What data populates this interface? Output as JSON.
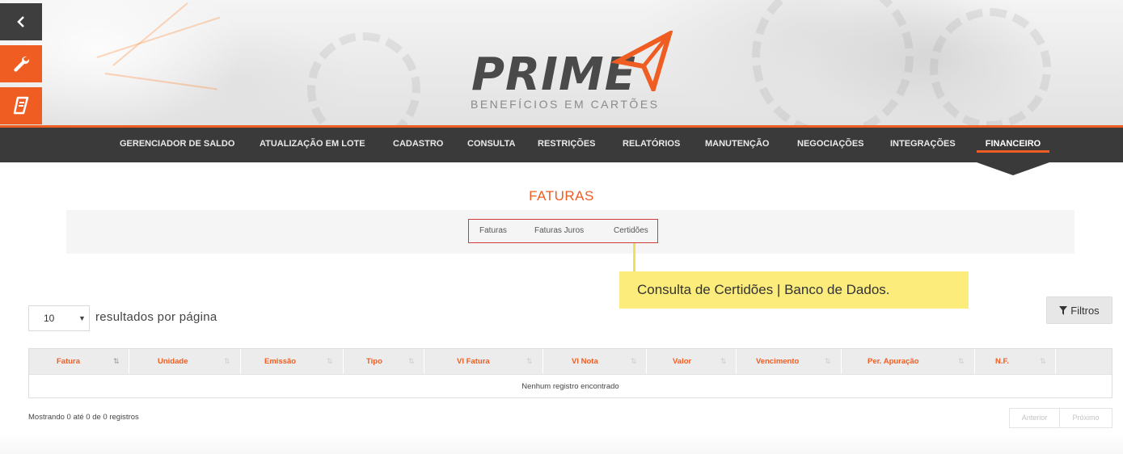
{
  "brand": {
    "logo_word": "PRIME",
    "logo_subtitle": "BENEFÍCIOS EM CARTÕES",
    "accent_color": "#ef5d22",
    "dark_color": "#3a3a3a"
  },
  "sidebar": {
    "items": [
      {
        "icon": "chevron-left-icon"
      },
      {
        "icon": "wrench-icon"
      },
      {
        "icon": "book-icon"
      }
    ]
  },
  "nav": {
    "items": [
      {
        "label": "GERENCIADOR DE SALDO"
      },
      {
        "label": "ATUALIZAÇÃO EM LOTE"
      },
      {
        "label": "CADASTRO"
      },
      {
        "label": "CONSULTA"
      },
      {
        "label": "RESTRIÇÕES"
      },
      {
        "label": "RELATÓRIOS"
      },
      {
        "label": "MANUTENÇÃO"
      },
      {
        "label": "NEGOCIAÇÕES"
      },
      {
        "label": "INTEGRAÇÕES"
      },
      {
        "label": "FINANCEIRO",
        "active": true
      }
    ]
  },
  "page": {
    "title": "FATURAS",
    "subtabs": [
      "Faturas",
      "Faturas Juros",
      "Certidões"
    ]
  },
  "callout": {
    "text": "Consulta de Certidões | Banco de Dados."
  },
  "table_controls": {
    "page_size": "10",
    "page_size_label": "resultados por página",
    "filter_label": "Filtros"
  },
  "table": {
    "columns": [
      "Fatura",
      "Unidade",
      "Emissão",
      "Tipo",
      "Vl Fatura",
      "Vl Nota",
      "Valor",
      "Vencimento",
      "Per. Apuração",
      "N.F."
    ],
    "empty_message": "Nenhum registro encontrado"
  },
  "footer": {
    "showing": "Mostrando 0 até 0 de 0 registros",
    "prev": "Anterior",
    "next": "Próximo"
  }
}
